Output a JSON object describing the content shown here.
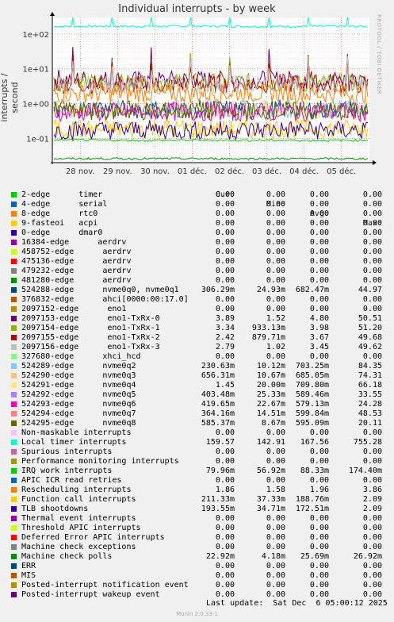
{
  "title": "Individual interrupts - by week",
  "ylabel": "interrupts / second",
  "watermark": "RRDTOOL / TOBI OETIKER",
  "headers": {
    "cur": "Cur:",
    "min": "Min:",
    "avg": "Avg:",
    "max": "Max:"
  },
  "legend": [
    {
      "name": "2-edge      timer",
      "color": "#00cc00",
      "cur": "0.00",
      "min": "0.00",
      "avg": "0.00",
      "max": "0.00"
    },
    {
      "name": "4-edge      serial",
      "color": "#0066b3",
      "cur": "0.00",
      "min": "0.00",
      "avg": "0.00",
      "max": "0.00"
    },
    {
      "name": "8-edge      rtc0",
      "color": "#ff8000",
      "cur": "0.00",
      "min": "0.00",
      "avg": "0.00",
      "max": "0.00"
    },
    {
      "name": "9-fasteoi   acpi",
      "color": "#ffcc00",
      "cur": "0.00",
      "min": "0.00",
      "avg": "0.00",
      "max": "0.00"
    },
    {
      "name": "0-edge      dmar0",
      "color": "#330099",
      "cur": "0.00",
      "min": "0.00",
      "avg": "0.00",
      "max": "0.00"
    },
    {
      "name": "16384-edge      aerdrv",
      "color": "#990099",
      "cur": "0.00",
      "min": "0.00",
      "avg": "0.00",
      "max": "0.00"
    },
    {
      "name": "458752-edge      aerdrv",
      "color": "#ccff00",
      "cur": "0.00",
      "min": "0.00",
      "avg": "0.00",
      "max": "0.00"
    },
    {
      "name": "475136-edge      aerdrv",
      "color": "#ff0000",
      "cur": "0.00",
      "min": "0.00",
      "avg": "0.00",
      "max": "0.00"
    },
    {
      "name": "479232-edge      aerdrv",
      "color": "#808080",
      "cur": "0.00",
      "min": "0.00",
      "avg": "0.00",
      "max": "0.00"
    },
    {
      "name": "481280-edge      aerdrv",
      "color": "#008f00",
      "cur": "0.00",
      "min": "0.00",
      "avg": "0.00",
      "max": "0.00"
    },
    {
      "name": "524288-edge      nvme0q0, nvme0q1",
      "color": "#00487d",
      "cur": "306.29m",
      "min": "24.93m",
      "avg": "682.47m",
      "max": "44.97"
    },
    {
      "name": "376832-edge      ahci[0000:00:17.0]",
      "color": "#b35a00",
      "cur": "0.00",
      "min": "0.00",
      "avg": "0.00",
      "max": "0.00"
    },
    {
      "name": "2097152-edge      eno1",
      "color": "#b38f00",
      "cur": "0.00",
      "min": "0.00",
      "avg": "0.00",
      "max": "0.00"
    },
    {
      "name": "2097153-edge      eno1-TxRx-0",
      "color": "#6b006b",
      "cur": "3.89",
      "min": "1.52",
      "avg": "4.80",
      "max": "50.51"
    },
    {
      "name": "2097154-edge      eno1-TxRx-1",
      "color": "#8fb300",
      "cur": "3.34",
      "min": "933.13m",
      "avg": "3.98",
      "max": "51.20"
    },
    {
      "name": "2097155-edge      eno1-TxRx-2",
      "color": "#b30000",
      "cur": "2.42",
      "min": "879.71m",
      "avg": "3.67",
      "max": "49.68"
    },
    {
      "name": "2097156-edge      eno1-TxRx-3",
      "color": "#bebebe",
      "cur": "2.79",
      "min": "1.02",
      "avg": "3.45",
      "max": "49.62"
    },
    {
      "name": "327680-edge      xhci_hcd",
      "color": "#80ff80",
      "cur": "0.00",
      "min": "0.00",
      "avg": "0.00",
      "max": "0.00"
    },
    {
      "name": "524289-edge      nvme0q2",
      "color": "#80c9ff",
      "cur": "230.63m",
      "min": "10.12m",
      "avg": "703.25m",
      "max": "84.35"
    },
    {
      "name": "524290-edge      nvme0q3",
      "color": "#ffc080",
      "cur": "656.31m",
      "min": "10.67m",
      "avg": "685.05m",
      "max": "74.31"
    },
    {
      "name": "524291-edge      nvme0q4",
      "color": "#ffe680",
      "cur": "1.45",
      "min": "20.00m",
      "avg": "709.80m",
      "max": "66.18"
    },
    {
      "name": "524292-edge      nvme0q5",
      "color": "#aa80ff",
      "cur": "403.48m",
      "min": "25.33m",
      "avg": "589.46m",
      "max": "33.55"
    },
    {
      "name": "524293-edge      nvme0q6",
      "color": "#ee00cc",
      "cur": "419.65m",
      "min": "22.67m",
      "avg": "579.13m",
      "max": "24.28"
    },
    {
      "name": "524294-edge      nvme0q7",
      "color": "#ff8080",
      "cur": "364.16m",
      "min": "14.51m",
      "avg": "599.84m",
      "max": "48.53"
    },
    {
      "name": "524295-edge      nvme0q8",
      "color": "#666600",
      "cur": "585.37m",
      "min": "8.67m",
      "avg": "595.09m",
      "max": "20.11"
    },
    {
      "name": "Non-maskable interrupts",
      "color": "#ffbfff",
      "cur": "0.00",
      "min": "0.00",
      "avg": "0.00",
      "max": "0.00"
    },
    {
      "name": "Local timer interrupts",
      "color": "#00ffcc",
      "cur": "159.57",
      "min": "142.91",
      "avg": "167.56",
      "max": "755.28"
    },
    {
      "name": "Spurious interrupts",
      "color": "#cc6699",
      "cur": "0.00",
      "min": "0.00",
      "avg": "0.00",
      "max": "0.00"
    },
    {
      "name": "Performance monitoring interrupts",
      "color": "#999900",
      "cur": "0.00",
      "min": "0.00",
      "avg": "0.00",
      "max": "0.00"
    },
    {
      "name": "IRQ work interrupts",
      "color": "#00cc00",
      "cur": "79.96m",
      "min": "56.92m",
      "avg": "88.33m",
      "max": "174.40m"
    },
    {
      "name": "APIC ICR read retries",
      "color": "#0066b3",
      "cur": "0.00",
      "min": "0.00",
      "avg": "0.00",
      "max": "0.00"
    },
    {
      "name": "Rescheduling interrupts",
      "color": "#ff8000",
      "cur": "1.86",
      "min": "1.58",
      "avg": "1.96",
      "max": "3.86"
    },
    {
      "name": "Function call interrupts",
      "color": "#ffcc00",
      "cur": "211.33m",
      "min": "37.33m",
      "avg": "188.76m",
      "max": "2.09"
    },
    {
      "name": "TLB shootdowns",
      "color": "#330099",
      "cur": "193.55m",
      "min": "34.71m",
      "avg": "172.51m",
      "max": "2.09"
    },
    {
      "name": "Thermal event interrupts",
      "color": "#990099",
      "cur": "0.00",
      "min": "0.00",
      "avg": "0.00",
      "max": "0.00"
    },
    {
      "name": "Threshold APIC interrupts",
      "color": "#ccff00",
      "cur": "0.00",
      "min": "0.00",
      "avg": "0.00",
      "max": "0.00"
    },
    {
      "name": "Deferred Error APIC interrupts",
      "color": "#ff0000",
      "cur": "0.00",
      "min": "0.00",
      "avg": "0.00",
      "max": "0.00"
    },
    {
      "name": "Machine check exceptions",
      "color": "#808080",
      "cur": "0.00",
      "min": "0.00",
      "avg": "0.00",
      "max": "0.00"
    },
    {
      "name": "Machine check polls",
      "color": "#008f00",
      "cur": "22.92m",
      "min": "4.18m",
      "avg": "25.69m",
      "max": "26.92m"
    },
    {
      "name": "ERR",
      "color": "#00487d",
      "cur": "0.00",
      "min": "0.00",
      "avg": "0.00",
      "max": "0.00"
    },
    {
      "name": "MIS",
      "color": "#b35a00",
      "cur": "0.00",
      "min": "0.00",
      "avg": "0.00",
      "max": "0.00"
    },
    {
      "name": "Posted-interrupt notification event",
      "color": "#b38f00",
      "cur": "0.00",
      "min": "0.00",
      "avg": "0.00",
      "max": "0.00"
    },
    {
      "name": "Posted-interrupt wakeup event",
      "color": "#6b006b",
      "cur": "0.00",
      "min": "0.00",
      "avg": "0.00",
      "max": "0.00"
    }
  ],
  "footer": "Last update:  Sat Dec  6 05:00:12 2025",
  "munin": "Munin 2.0.33-1",
  "chart_data": {
    "type": "line",
    "title": "Individual interrupts - by week",
    "ylabel": "interrupts / second",
    "yscale": "log",
    "ylim": [
      0.02,
      300
    ],
    "yticks": [
      {
        "label": "1e-01",
        "value": 0.1
      },
      {
        "label": "1e+00",
        "value": 1
      },
      {
        "label": "1e+01",
        "value": 10
      },
      {
        "label": "1e+02",
        "value": 100
      }
    ],
    "x": [
      "28 nov.",
      "29 nov.",
      "30 nov.",
      "01 déc.",
      "02 déc.",
      "03 déc.",
      "04 déc.",
      "05 déc."
    ],
    "grid": true,
    "series": [
      {
        "name": "Local timer interrupts",
        "color": "#00ffcc",
        "values": [
          165,
          168,
          166,
          170,
          167,
          165,
          168,
          166
        ]
      },
      {
        "name": "2097153-edge      eno1-TxRx-0",
        "color": "#6b006b",
        "values": [
          5.2,
          4.9,
          4.6,
          4.8,
          4.7,
          4.9,
          4.8,
          4.5
        ]
      },
      {
        "name": "2097154-edge      eno1-TxRx-1",
        "color": "#8fb300",
        "values": [
          4.1,
          3.9,
          3.8,
          4.0,
          4.1,
          3.9,
          3.8,
          4.0
        ]
      },
      {
        "name": "2097155-edge      eno1-TxRx-2",
        "color": "#b30000",
        "values": [
          3.8,
          3.6,
          3.5,
          3.7,
          3.6,
          3.8,
          3.7,
          3.6
        ]
      },
      {
        "name": "2097156-edge      eno1-TxRx-3",
        "color": "#bebebe",
        "values": [
          3.5,
          3.4,
          3.3,
          3.5,
          3.4,
          3.5,
          3.4,
          3.3
        ]
      },
      {
        "name": "Rescheduling interrupts",
        "color": "#ff8000",
        "values": [
          2.0,
          1.9,
          2.0,
          1.9,
          2.0,
          2.0,
          1.9,
          1.9
        ]
      },
      {
        "name": "524289-edge      nvme0q2",
        "color": "#80c9ff",
        "values": [
          0.7,
          0.72,
          0.69,
          0.71,
          0.7,
          0.7,
          0.71,
          0.7
        ]
      },
      {
        "name": "524288-edge      nvme0q0, nvme0q1",
        "color": "#00487d",
        "values": [
          0.68,
          0.7,
          0.67,
          0.69,
          0.68,
          0.68,
          0.69,
          0.68
        ]
      },
      {
        "name": "524291-edge      nvme0q4",
        "color": "#ffe680",
        "values": [
          0.71,
          0.72,
          0.7,
          0.71,
          0.7,
          0.72,
          0.71,
          0.7
        ]
      },
      {
        "name": "524293-edge      nvme0q6",
        "color": "#ee00cc",
        "values": [
          0.58,
          0.57,
          0.59,
          0.58,
          0.57,
          0.58,
          0.58,
          0.57
        ]
      },
      {
        "name": "524295-edge      nvme0q8",
        "color": "#666600",
        "values": [
          0.6,
          0.59,
          0.6,
          0.6,
          0.59,
          0.6,
          0.6,
          0.59
        ]
      },
      {
        "name": "Function call interrupts",
        "color": "#ffcc00",
        "values": [
          0.19,
          0.18,
          0.19,
          0.19,
          0.18,
          0.19,
          0.19,
          0.18
        ]
      },
      {
        "name": "TLB shootdowns",
        "color": "#330099",
        "values": [
          0.17,
          0.17,
          0.18,
          0.17,
          0.17,
          0.18,
          0.17,
          0.17
        ]
      },
      {
        "name": "IRQ work interrupts",
        "color": "#00cc00",
        "values": [
          0.09,
          0.088,
          0.087,
          0.089,
          0.088,
          0.088,
          0.087,
          0.088
        ]
      },
      {
        "name": "Machine check polls",
        "color": "#008f00",
        "values": [
          0.026,
          0.026,
          0.026,
          0.026,
          0.026,
          0.026,
          0.026,
          0.026
        ]
      }
    ]
  }
}
